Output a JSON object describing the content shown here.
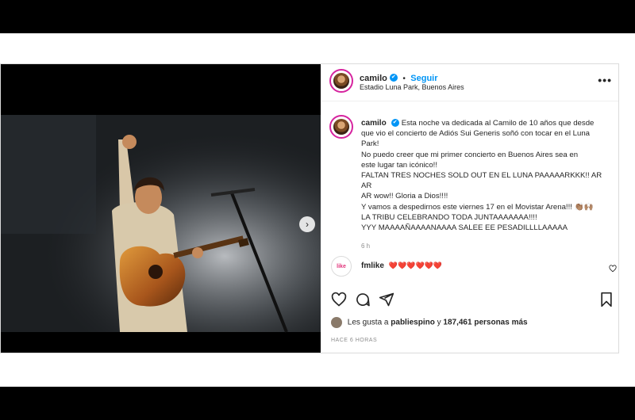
{
  "post": {
    "username": "camilo",
    "follow_label": "Seguir",
    "location": "Estadio Luna Park, Buenos Aires",
    "more_label": "•••",
    "caption_lines": [
      "Esta noche va dedicada al Camilo de 10 años que desde",
      "que vio el concierto de Adiós Sui Generis soñó con tocar en el Luna",
      "Park!",
      "No puedo creer que mi primer concierto en Buenos Aires sea en",
      "este lugar tan icónico!!",
      "FALTAN TRES NOCHES SOLD OUT EN EL LUNA PAAAAARKKK!! AR AR",
      "AR wow!! Gloria a Dios!!!!",
      "Y vamos a despedirnos este viernes 17 en el Movistar Arena!!! 👏🏽🙌🏽",
      "LA TRIBU CELEBRANDO TODA JUNTAAAAAAA!!!!",
      "YYY MAAAAÑAAAANAAAA SALEE EE PESADILLLLAAAAA"
    ],
    "time": "6 h",
    "comment": {
      "username": "fmlike",
      "text": "❤️❤️❤️❤️❤️❤️",
      "avatar_text": "like"
    },
    "likes": {
      "prefix": "Les gusta a",
      "user": "pabliespino",
      "middle": "y",
      "count": "187,461 personas más"
    },
    "time_ago": "HACE 6 HORAS"
  },
  "icons": [
    "verified-icon",
    "more-icon",
    "heart-icon",
    "comment-icon",
    "share-icon",
    "bookmark-icon",
    "chevron-right-icon"
  ],
  "colors": {
    "accent": "#0095f6",
    "ring": "#d6249f",
    "heart": "#ed4956"
  }
}
